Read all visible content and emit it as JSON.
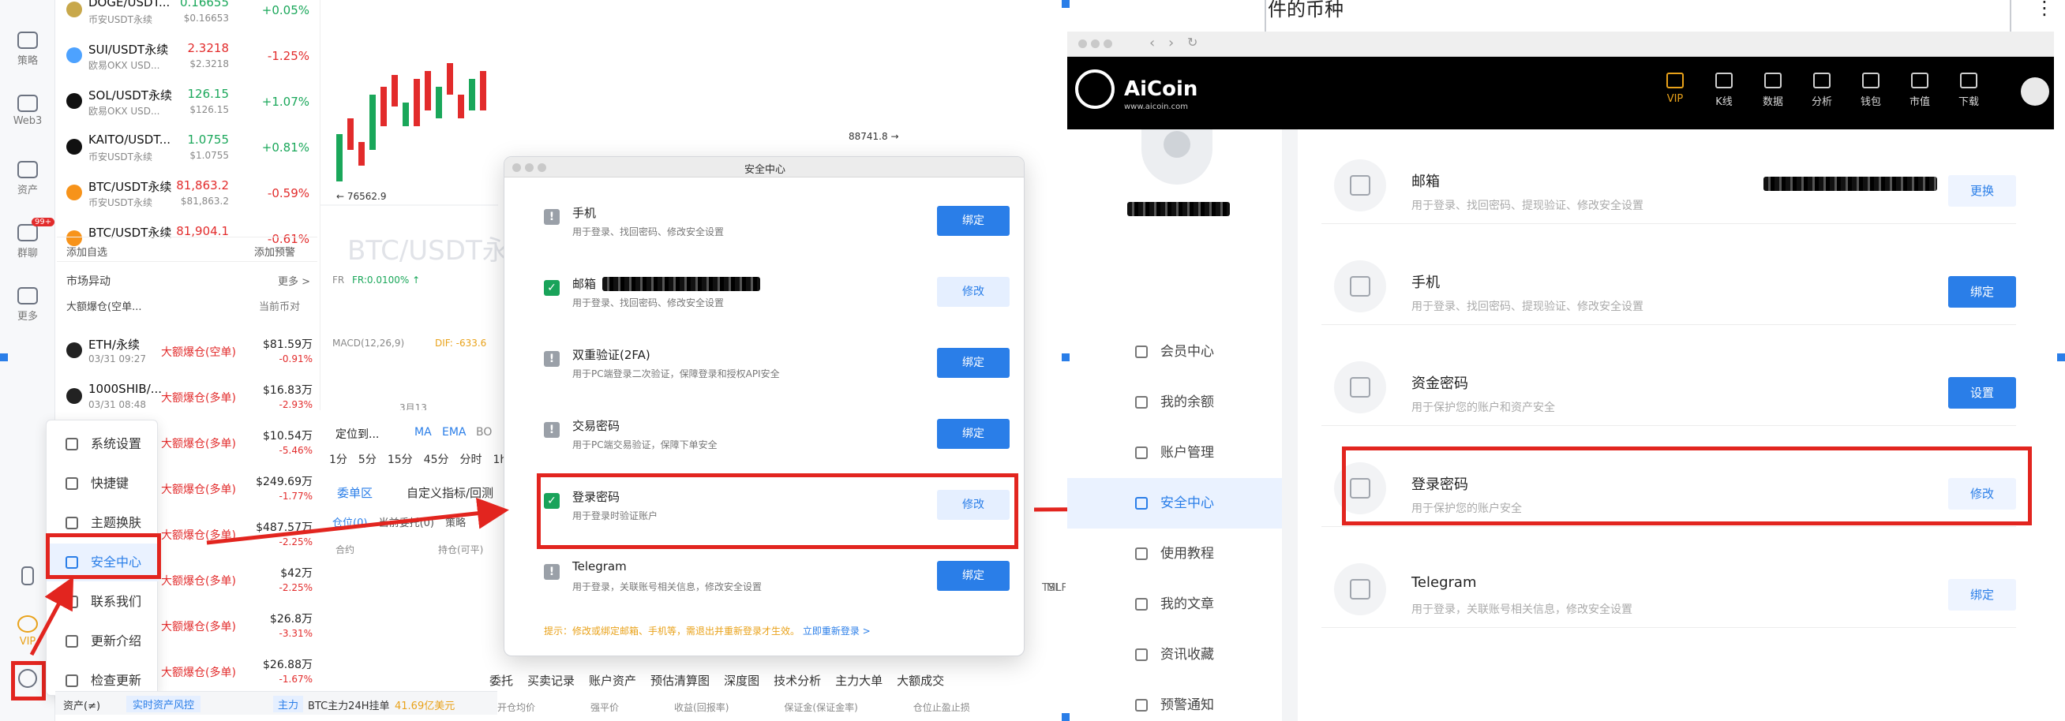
{
  "left": {
    "rail": [
      {
        "label": "策略"
      },
      {
        "label": "Web3"
      },
      {
        "label": "资产"
      },
      {
        "label": "群聊",
        "badge": "99+"
      },
      {
        "label": "更多"
      },
      {
        "label": "VIP"
      }
    ],
    "market_rows": [
      {
        "name": "DOGE/USDT...",
        "sub": "币安USDT永续",
        "price": "0.16655",
        "sub_price": "$0.16653",
        "change": "+0.05%",
        "dir": "up",
        "coin_color": "#c8a84b"
      },
      {
        "name": "SUI/USDT永续",
        "sub": "欧易OKX USD...",
        "price": "2.3218",
        "sub_price": "$2.3218",
        "change": "-1.25%",
        "dir": "down",
        "coin_color": "#4da2ff"
      },
      {
        "name": "SOL/USDT永续",
        "sub": "欧易OKX USD...",
        "price": "126.15",
        "sub_price": "$126.15",
        "change": "+1.07%",
        "dir": "up",
        "coin_color": "#111111"
      },
      {
        "name": "KAITO/USDT...",
        "sub": "币安USDT永续",
        "price": "1.0755",
        "sub_price": "$1.0755",
        "change": "+0.81%",
        "dir": "up",
        "coin_color": "#111111"
      },
      {
        "name": "BTC/USDT永续",
        "sub": "币安USDT永续",
        "price": "81,863.2",
        "sub_price": "$81,863.2",
        "change": "-0.59%",
        "dir": "down",
        "coin_color": "#f7931a"
      },
      {
        "name": "BTC/USDT永续",
        "sub": "",
        "price": "81,904.1",
        "sub_price": "",
        "change": "-0.61%",
        "dir": "down",
        "coin_color": "#f7931a"
      }
    ],
    "add_watch": "添加自选",
    "add_alert": "添加预警",
    "market_move": "市场异动",
    "more": "更多 >",
    "filter": "大额爆仓(空单...",
    "current_coin": "当前币对",
    "liq_rows": [
      {
        "name": "ETH/永续",
        "time": "03/31 09:27",
        "tag": "大额爆仓(空单)",
        "amount": "$81.59万",
        "pct": "-0.91%"
      },
      {
        "name": "1000SHIB/...",
        "time": "03/31 08:48",
        "tag": "大额爆仓(多单)",
        "amount": "$16.83万",
        "pct": "-2.93%"
      },
      {
        "name": "",
        "time": "",
        "tag": "大额爆仓(多单)",
        "amount": "$10.54万",
        "pct": "-5.46%"
      },
      {
        "name": "",
        "time": "",
        "tag": "大额爆仓(多单)",
        "amount": "$249.69万",
        "pct": "-1.77%"
      },
      {
        "name": "",
        "time": "",
        "tag": "大额爆仓(多单)",
        "amount": "$487.57万",
        "pct": "-2.25%"
      },
      {
        "name": "",
        "time": "",
        "tag": "大额爆仓(多单)",
        "amount": "$42万",
        "pct": "-2.25%"
      },
      {
        "name": "",
        "time": "",
        "tag": "大额爆仓(多单)",
        "amount": "$26.8万",
        "pct": "-3.31%"
      },
      {
        "name": "",
        "time": "",
        "tag": "大额爆仓(多单)",
        "amount": "$26.88万",
        "pct": "-1.67%"
      }
    ],
    "settings_menu": [
      {
        "label": "系统设置"
      },
      {
        "label": "快捷键"
      },
      {
        "label": "主题换肤"
      },
      {
        "label": "安全中心"
      },
      {
        "label": "联系我们"
      },
      {
        "label": "更新介绍"
      },
      {
        "label": "检查更新"
      }
    ],
    "chart": {
      "watermark": "BTC/USDT永",
      "price_high": "88741.8 →",
      "price_low": "← 76562.9",
      "fr_label": "FR",
      "fr_value": "FR:0.0100% ↑",
      "macd": "MACD(12,26,9)",
      "dif": "DIF: -633.6",
      "date": "3月13",
      "locate": "定位到...",
      "ma": "MA",
      "ema": "EMA",
      "bo": "BO",
      "intervals": [
        "1分",
        "5分",
        "15分",
        "45分",
        "分时",
        "1h"
      ],
      "tab_orders": "委单区",
      "tab_custom": "自定义指标/回测",
      "sub_tabs": [
        "仓位(0)",
        "当前委托(0)",
        "策略"
      ],
      "cols": [
        "合约",
        "持仓(可平)"
      ]
    },
    "bottom": {
      "tabs": [
        "委托",
        "买卖记录",
        "账户资产",
        "预估清算图",
        "深度图",
        "技术分析",
        "主力大单",
        "大额成交"
      ],
      "cols": [
        "开仓均价",
        "强平价",
        "收益(回报率)",
        "保证金(保证金率)",
        "仓位止盈止损"
      ],
      "status_assets": "资产(≠)",
      "status_risk": "实时资产风控",
      "status_main": "主力",
      "status_ticker": "BTC主力24H挂单",
      "status_amount": "41.69亿美元",
      "right_labels": [
        "TSI",
        "MLF"
      ]
    }
  },
  "dialog": {
    "title": "安全中心",
    "rows": [
      {
        "title": "手机",
        "desc": "用于登录、找回密码、修改安全设置",
        "status": "warn",
        "button": "绑定",
        "style": "primary"
      },
      {
        "title": "邮箱",
        "desc": "用于登录、找回密码、修改安全设置",
        "status": "ok",
        "button": "修改",
        "style": "light"
      },
      {
        "title": "双重验证(2FA)",
        "desc": "用于PC端登录二次验证，保障登录和授权API安全",
        "status": "warn",
        "button": "绑定",
        "style": "primary"
      },
      {
        "title": "交易密码",
        "desc": "用于PC端交易验证，保障下单安全",
        "status": "warn",
        "button": "绑定",
        "style": "primary"
      },
      {
        "title": "登录密码",
        "desc": "用于登录时验证账户",
        "status": "ok",
        "button": "修改",
        "style": "light"
      },
      {
        "title": "Telegram",
        "desc": "用于登录，关联账号相关信息，修改安全设置",
        "status": "warn",
        "button": "绑定",
        "style": "primary"
      }
    ],
    "tip": "提示：修改或绑定邮箱、手机等，需退出并重新登录才生效。",
    "relogin": "立即重新登录 >"
  },
  "right": {
    "top_text": "件的币种",
    "logo": "AiCoin",
    "logo_sub": "www.aicoin.com",
    "nav": [
      {
        "label": "VIP"
      },
      {
        "label": "K线"
      },
      {
        "label": "数据"
      },
      {
        "label": "分析"
      },
      {
        "label": "钱包"
      },
      {
        "label": "市值"
      },
      {
        "label": "下载"
      }
    ],
    "sidebar": [
      {
        "label": "会员中心"
      },
      {
        "label": "我的余额"
      },
      {
        "label": "账户管理"
      },
      {
        "label": "安全中心"
      },
      {
        "label": "使用教程"
      },
      {
        "label": "我的文章"
      },
      {
        "label": "资讯收藏"
      },
      {
        "label": "预警通知"
      }
    ],
    "rows": [
      {
        "title": "邮箱",
        "desc": "用于登录、找回密码、提现验证、修改安全设置",
        "button": "更换",
        "style": "light"
      },
      {
        "title": "手机",
        "desc": "用于登录、找回密码、提现验证、修改安全设置",
        "button": "绑定",
        "style": "primary"
      },
      {
        "title": "资金密码",
        "desc": "用于保护您的账户和资产安全",
        "button": "设置",
        "style": "primary"
      },
      {
        "title": "登录密码",
        "desc": "用于保护您的账户安全",
        "button": "修改",
        "style": "light"
      },
      {
        "title": "Telegram",
        "desc": "用于登录，关联账号相关信息，修改安全设置",
        "button": "绑定",
        "style": "light"
      }
    ]
  },
  "colors": {
    "accent": "#2a7ee8",
    "annotation_red": "#e2251f",
    "up": "#1aa75a",
    "down": "#e22b2b",
    "header_bg": "#000000"
  }
}
